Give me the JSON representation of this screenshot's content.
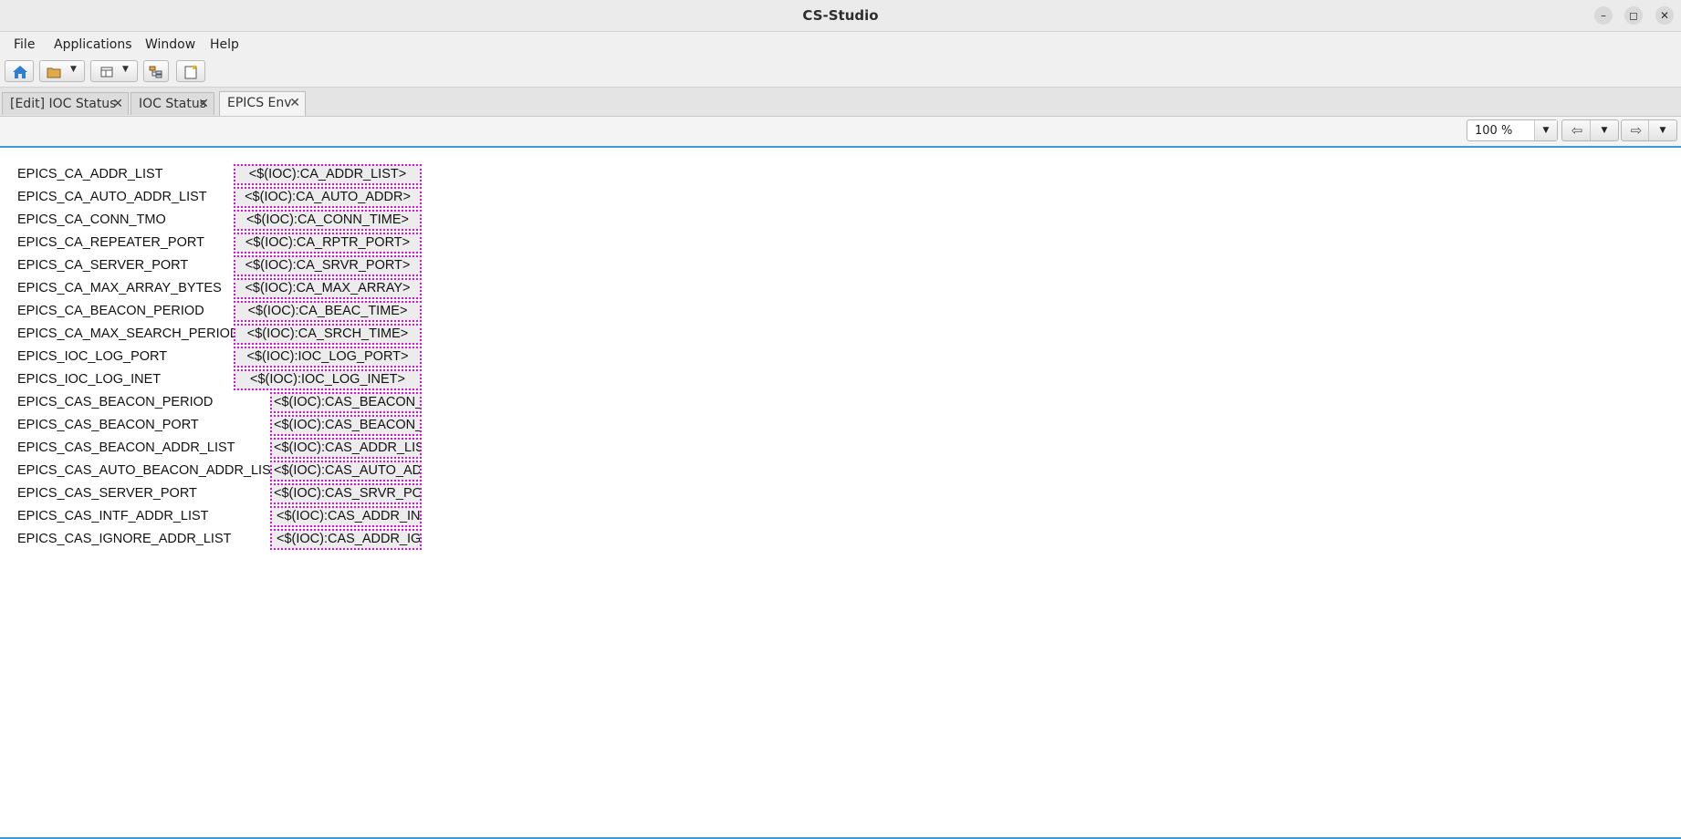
{
  "window": {
    "title": "CS-Studio",
    "minimize": "–",
    "maximize": "◻",
    "close": "✕"
  },
  "menu": [
    "File",
    "Applications",
    "Window",
    "Help"
  ],
  "toolbar": {
    "buttons": [
      "home-icon",
      "open-folder-icon",
      "layout-icon",
      "tree-icon",
      "new-display-icon"
    ]
  },
  "tabs": [
    {
      "label": "[Edit] IOC Status",
      "close": "✕"
    },
    {
      "label": "IOC Status",
      "close": "✕"
    },
    {
      "label": "EPICS Env",
      "close": "✕",
      "active": true
    }
  ],
  "display_toolbar": {
    "zoom": "100 %",
    "back_arrow": "⇦",
    "forward_arrow": "⇨",
    "dropdown": "▼"
  },
  "rows": [
    {
      "label": "EPICS_CA_ADDR_LIST",
      "value": "<$(IOC):CA_ADDR_LIST>"
    },
    {
      "label": "EPICS_CA_AUTO_ADDR_LIST",
      "value": "<$(IOC):CA_AUTO_ADDR>"
    },
    {
      "label": "EPICS_CA_CONN_TMO",
      "value": "<$(IOC):CA_CONN_TIME>"
    },
    {
      "label": "EPICS_CA_REPEATER_PORT",
      "value": "<$(IOC):CA_RPTR_PORT>"
    },
    {
      "label": "EPICS_CA_SERVER_PORT",
      "value": "<$(IOC):CA_SRVR_PORT>"
    },
    {
      "label": "EPICS_CA_MAX_ARRAY_BYTES",
      "value": "<$(IOC):CA_MAX_ARRAY>"
    },
    {
      "label": "EPICS_CA_BEACON_PERIOD",
      "value": "<$(IOC):CA_BEAC_TIME>"
    },
    {
      "label": "EPICS_CA_MAX_SEARCH_PERIOD",
      "value": "<$(IOC):CA_SRCH_TIME>"
    },
    {
      "label": "EPICS_IOC_LOG_PORT",
      "value": "<$(IOC):IOC_LOG_PORT>"
    },
    {
      "label": "EPICS_IOC_LOG_INET",
      "value": "<$(IOC):IOC_LOG_INET>"
    },
    {
      "label": "EPICS_CAS_BEACON_PERIOD",
      "value": "<$(IOC):CAS_BEACON_"
    },
    {
      "label": "EPICS_CAS_BEACON_PORT",
      "value": "<$(IOC):CAS_BEACON_"
    },
    {
      "label": "EPICS_CAS_BEACON_ADDR_LIST",
      "value": "<$(IOC):CAS_ADDR_LIS"
    },
    {
      "label": "EPICS_CAS_AUTO_BEACON_ADDR_LIST",
      "value": "<$(IOC):CAS_AUTO_AD"
    },
    {
      "label": "EPICS_CAS_SERVER_PORT",
      "value": "<$(IOC):CAS_SRVR_PO"
    },
    {
      "label": "EPICS_CAS_INTF_ADDR_LIST",
      "value": "<$(IOC):CAS_ADDR_IN"
    },
    {
      "label": "EPICS_CAS_IGNORE_ADDR_LIST",
      "value": "<$(IOC):CAS_ADDR_IG"
    }
  ]
}
